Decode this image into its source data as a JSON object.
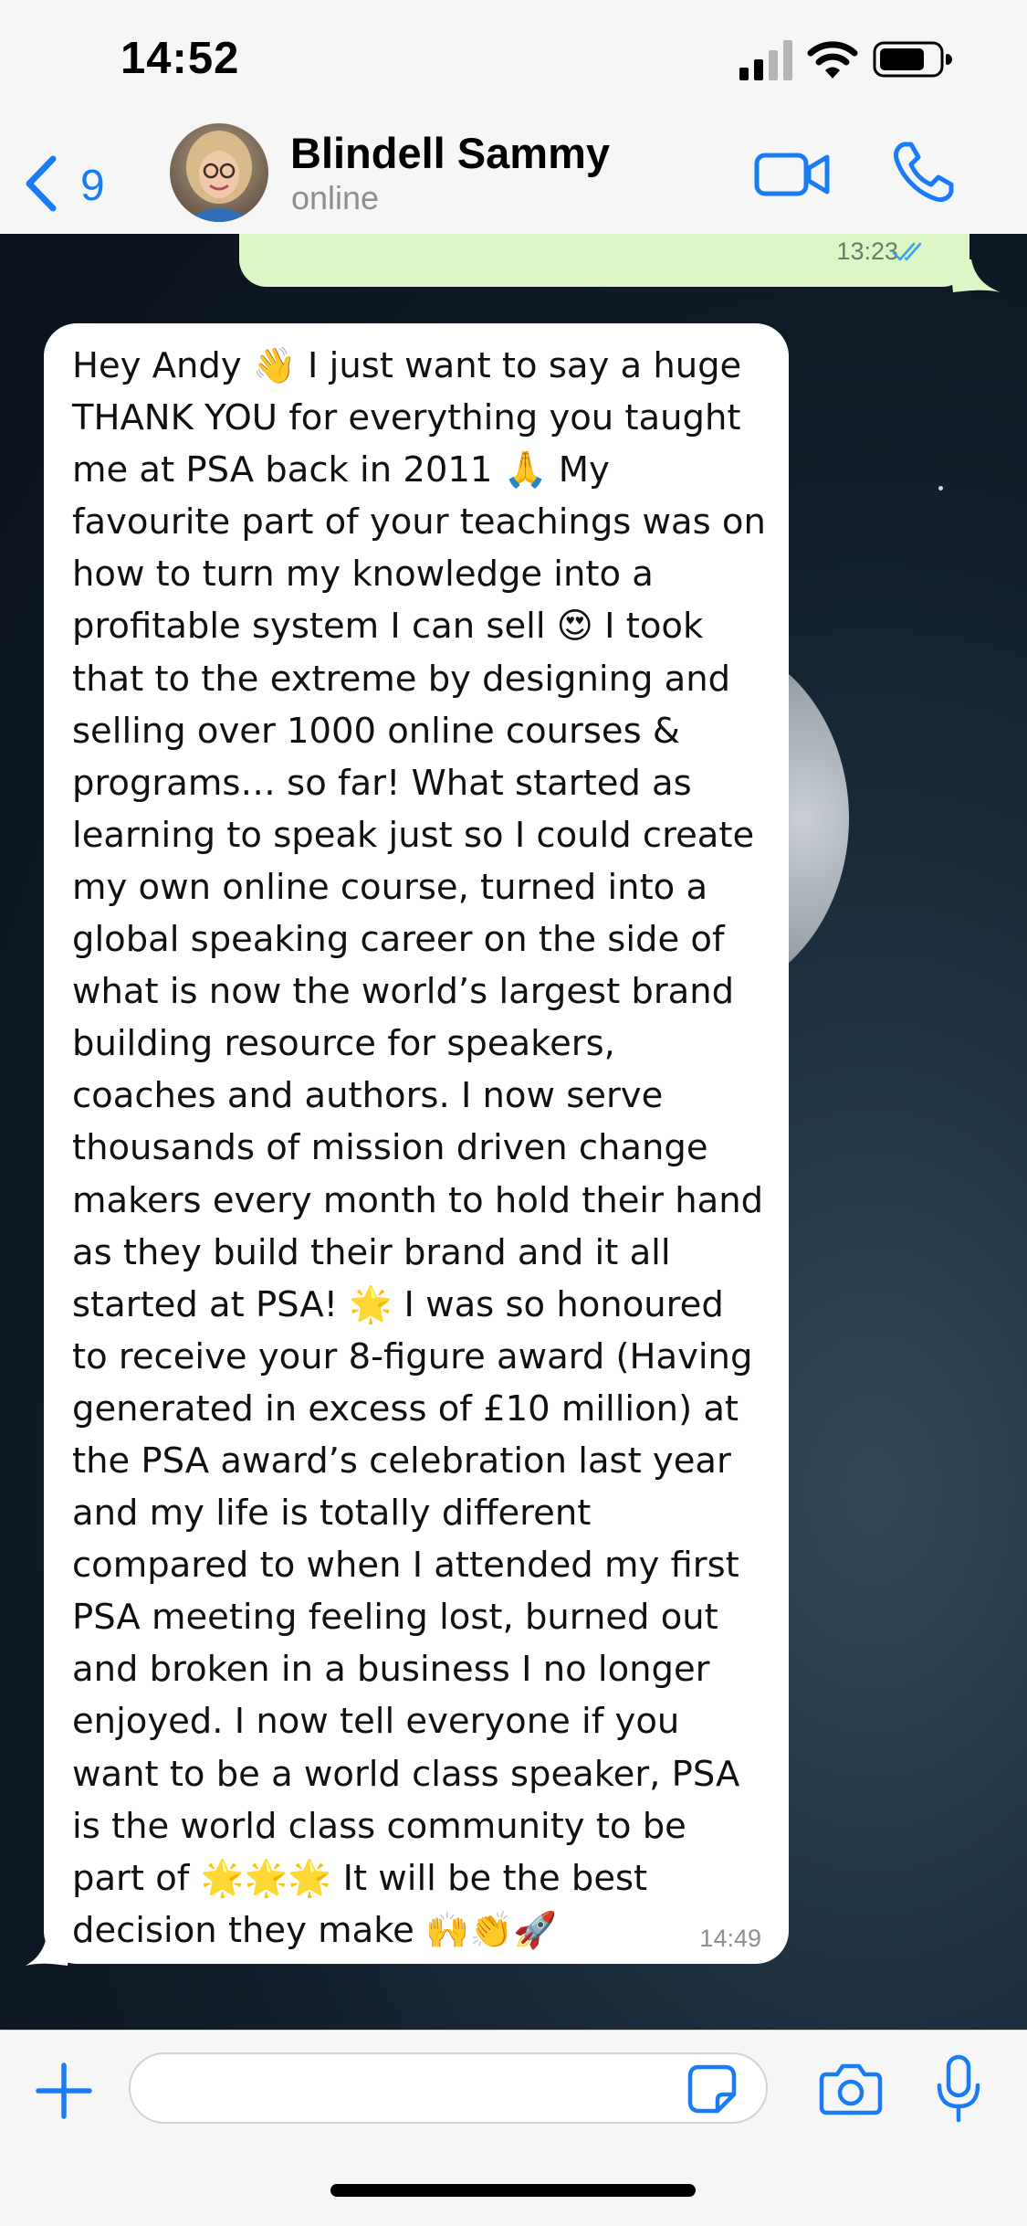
{
  "status_bar": {
    "time": "14:52",
    "icons": [
      "signal-icon",
      "wifi-icon",
      "battery-icon"
    ]
  },
  "header": {
    "back_count": "9",
    "contact_name": "Blindell Sammy",
    "contact_status": "online",
    "icons": [
      "back-chevron-icon",
      "video-camera-icon",
      "phone-icon"
    ],
    "accent_color": "#1a7cf5"
  },
  "messages": [
    {
      "direction": "outgoing",
      "time": "13:23",
      "status": "read",
      "bubble_color": "#dcf7c5"
    },
    {
      "direction": "incoming",
      "time": "14:49",
      "bubble_color": "#ffffff",
      "text": "Hey Andy 👋 I just want to say a huge\nTHANK YOU for everything you taught\nme at PSA back in 2011 🙏 My\nfavourite part of your teachings was on\nhow to turn my knowledge into a\nprofitable system I can sell 😍 I took\nthat to the extreme by designing and\nselling over 1000 online courses &\nprograms… so far! What started as\nlearning to speak just so I could create\nmy own online course, turned into a\nglobal speaking career on the side of\nwhat is now the world’s largest brand\nbuilding resource for speakers,\ncoaches and authors. I now serve\nthousands of mission driven change\nmakers every month to hold their hand\nas they build their brand and it all\nstarted at PSA! 🌟 I was so honoured\nto receive your 8-figure award (Having\ngenerated in excess of £10 million) at\nthe PSA award’s celebration last year\nand my life is totally different\ncompared to when I attended my first\nPSA meeting feeling lost, burned out\nand broken in a business I no longer\nenjoyed. I now tell everyone if you\nwant to be a world class speaker, PSA\nis the world class community to be\npart of 🌟🌟🌟 It will be the best\ndecision they make 🙌👏🚀"
    }
  ],
  "input_bar": {
    "placeholder": "",
    "icons": [
      "plus-icon",
      "sticker-icon",
      "camera-icon",
      "microphone-icon"
    ]
  }
}
